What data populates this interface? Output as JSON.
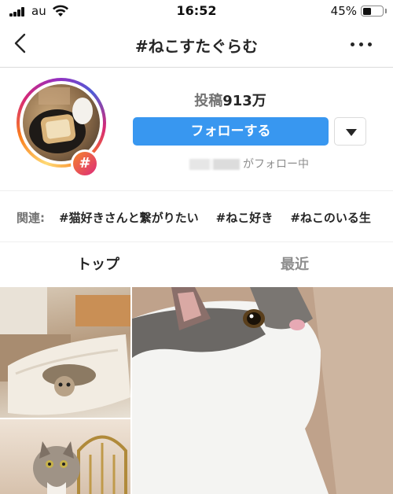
{
  "status_bar": {
    "carrier": "au",
    "time": "16:52",
    "battery_percent": "45%",
    "battery_level": 0.45
  },
  "nav": {
    "title": "#ねこすたぐらむ"
  },
  "profile": {
    "badge_symbol": "#",
    "posts_label": "投稿",
    "posts_count": "913万",
    "follow_label": "フォローする",
    "followed_by_suffix": "がフォロー中"
  },
  "related": {
    "label": "関連:",
    "tags": [
      "#猫好きさんと繋がりたい",
      "#ねこ好き",
      "#ねこのいる生"
    ]
  },
  "tabs": [
    {
      "label": "トップ"
    },
    {
      "label": "最近"
    }
  ],
  "colors": {
    "follow_button": "#3897f0",
    "ring_gradient": [
      "#feda75",
      "#fa7e1e",
      "#d62976",
      "#962fbf",
      "#4f5bd5"
    ]
  }
}
